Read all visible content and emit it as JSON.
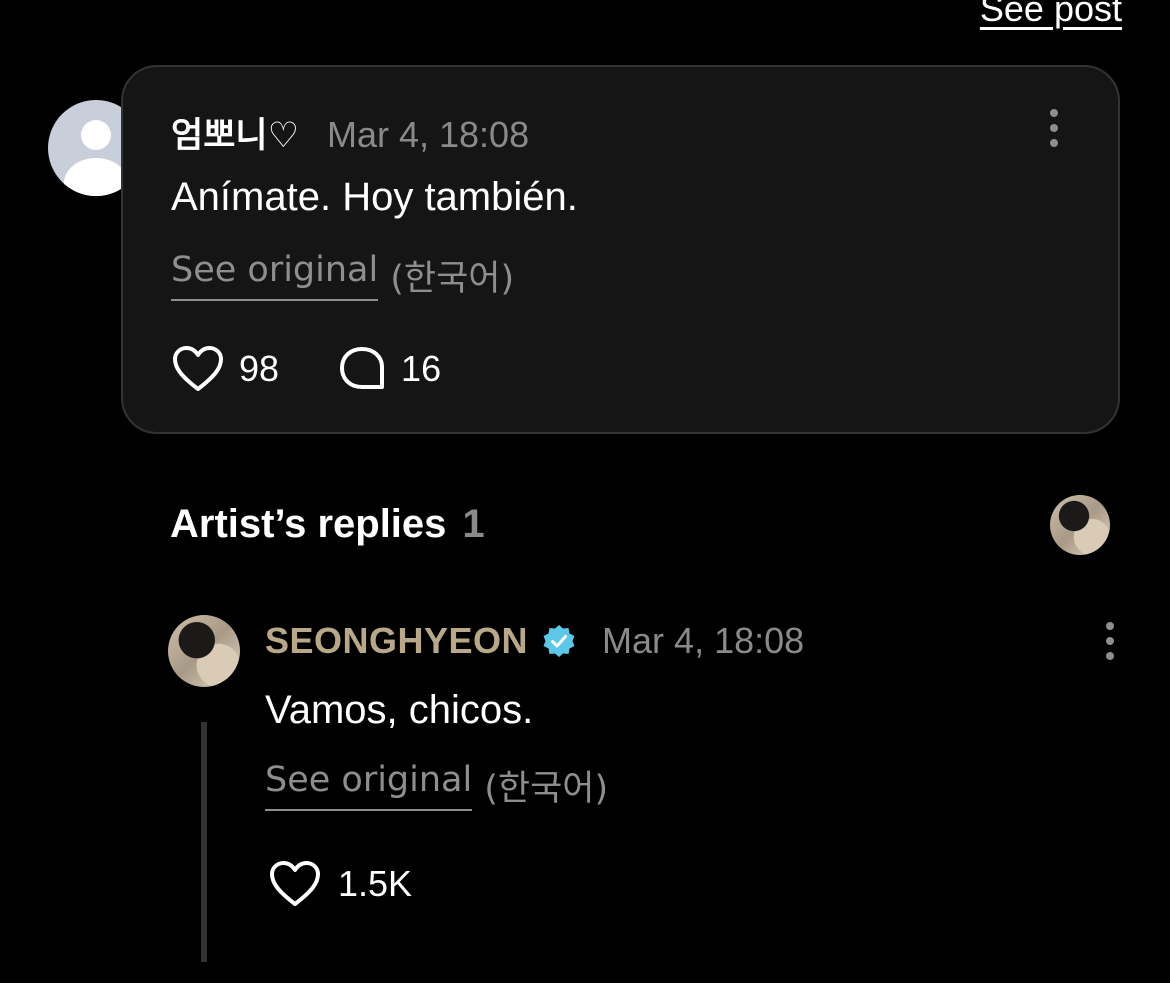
{
  "header": {
    "see_post_label": "See post"
  },
  "comment": {
    "username": "엄뽀니♡",
    "timestamp": "Mar 4, 18:08",
    "text": "Anímate. Hoy también.",
    "see_original_label": "See original",
    "original_language": "(한국어)",
    "likes": "98",
    "replies": "16",
    "avatar_icon": "default-user-avatar",
    "more_icon": "more-vertical-icon"
  },
  "artist_replies": {
    "heading": "Artist’s replies",
    "count": "1",
    "reply": {
      "artist_name": "SEONGHYEON",
      "verified_icon": "verified-badge-icon",
      "verified_color": "#5bc8e8",
      "timestamp": "Mar 4, 18:08",
      "text": "Vamos, chicos.",
      "see_original_label": "See original",
      "original_language": "(한국어)",
      "likes": "1.5K"
    }
  },
  "colors": {
    "background": "#000000",
    "card": "#151515",
    "artist_name": "#b8a888",
    "muted_text": "#8a8a8a"
  }
}
